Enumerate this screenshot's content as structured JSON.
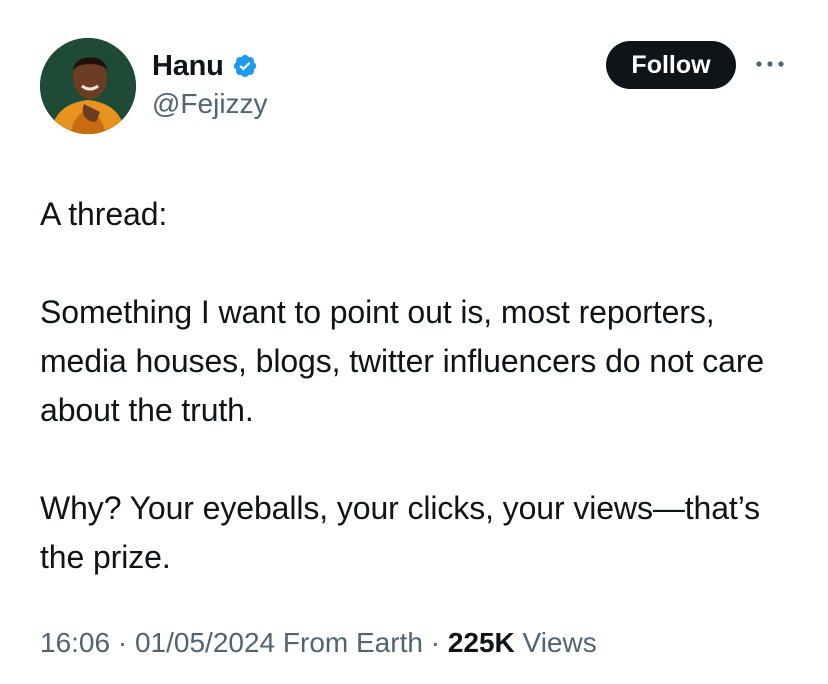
{
  "author": {
    "display_name": "Hanu",
    "handle": "@Fejizzy",
    "verified_icon": "verified-badge-icon",
    "avatar_icon": "profile-photo"
  },
  "actions": {
    "follow_label": "Follow",
    "more_icon": "more-options-icon"
  },
  "tweet": {
    "paragraphs": [
      "A thread:",
      "Something I want to point out is, most reporters, media houses, blogs, twitter influencers do not care about the truth.",
      "Why? Your eyeballs, your clicks, your views—that’s the prize."
    ]
  },
  "meta": {
    "time": "16:06",
    "separator1": " · ",
    "date": "01/05/2024",
    "source": "From Earth",
    "separator2": " · ",
    "views_count": "225K",
    "views_label": "Views"
  },
  "colors": {
    "text_primary": "#0f1419",
    "text_secondary": "#536471",
    "verified_blue": "#1d9bf0",
    "follow_bg": "#0f1419"
  }
}
